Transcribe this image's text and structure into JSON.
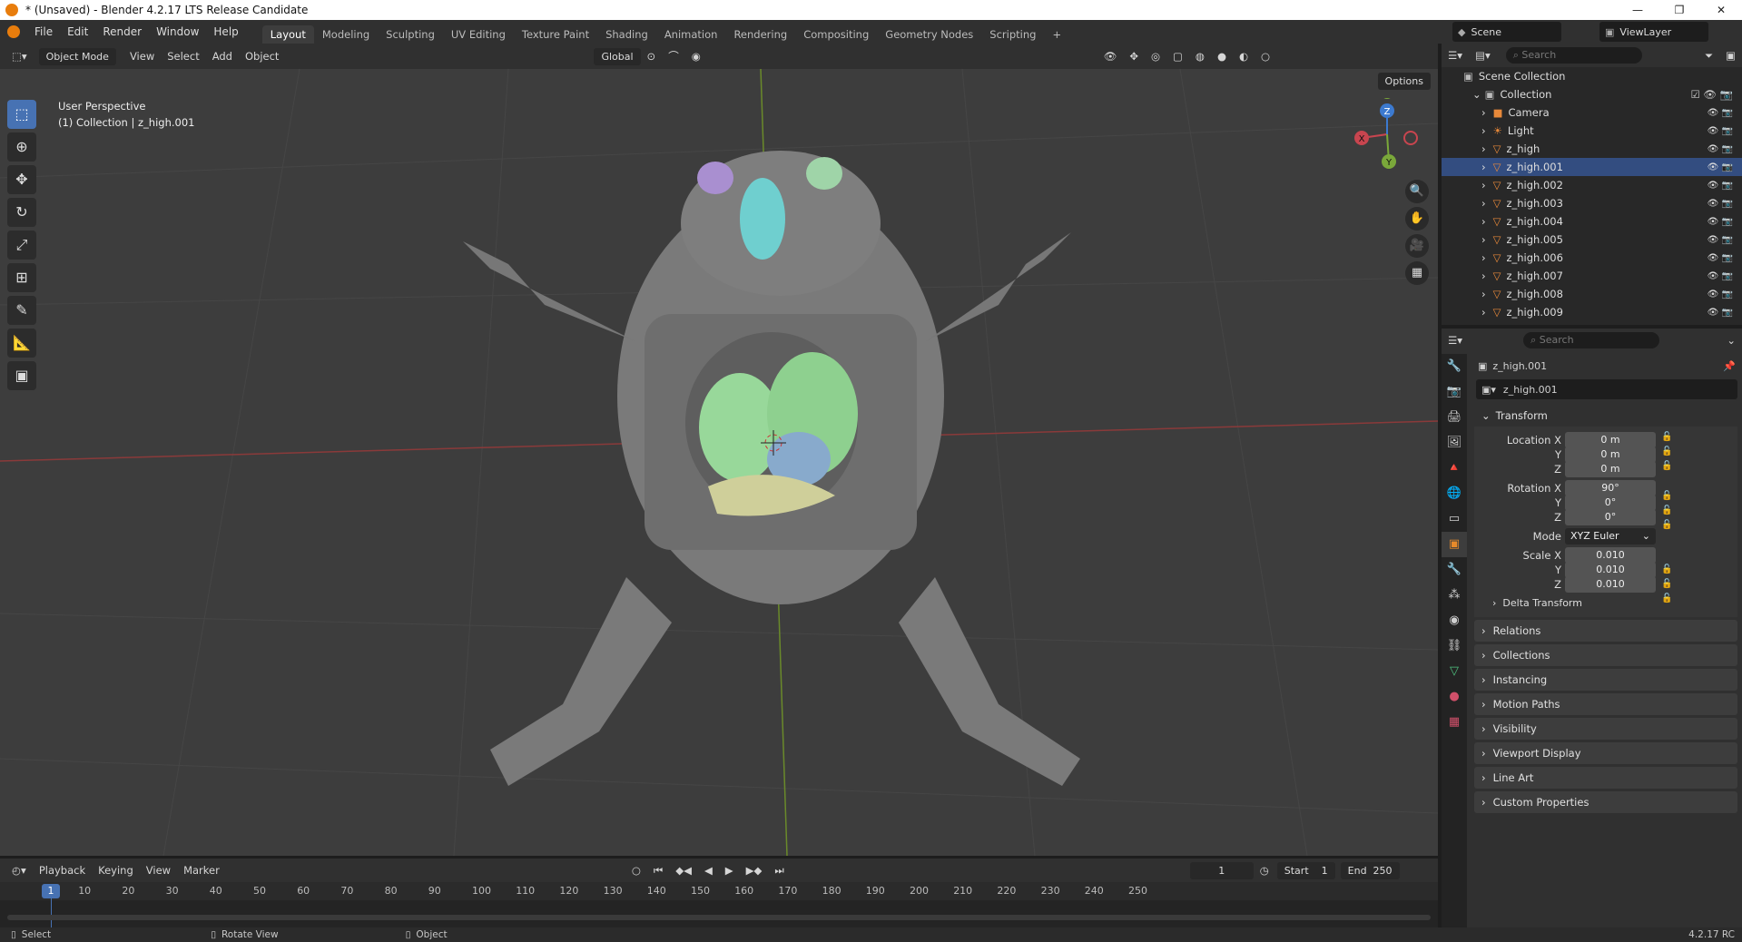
{
  "window": {
    "title": "* (Unsaved) - Blender 4.2.17 LTS Release Candidate",
    "min": "—",
    "max": "❐",
    "close": "✕"
  },
  "menu": {
    "file": "File",
    "edit": "Edit",
    "render": "Render",
    "window": "Window",
    "help": "Help"
  },
  "workspaces": [
    "Layout",
    "Modeling",
    "Sculpting",
    "UV Editing",
    "Texture Paint",
    "Shading",
    "Animation",
    "Rendering",
    "Compositing",
    "Geometry Nodes",
    "Scripting"
  ],
  "add_workspace": "+",
  "scene": {
    "name": "Scene",
    "view_layer": "ViewLayer"
  },
  "viewport_header": {
    "mode": "Object Mode",
    "view": "View",
    "select": "Select",
    "add": "Add",
    "object": "Object",
    "orientation": "Global",
    "options": "Options"
  },
  "viewport": {
    "perspective": "User Perspective",
    "collection_info": "(1) Collection | z_high.001"
  },
  "gizmo": {
    "x": "X",
    "y": "Y",
    "z": "Z"
  },
  "outliner": {
    "search_placeholder": "Search",
    "scene_collection": "Scene Collection",
    "collection": "Collection",
    "items": [
      "Camera",
      "Light",
      "z_high",
      "z_high.001",
      "z_high.002",
      "z_high.003",
      "z_high.004",
      "z_high.005",
      "z_high.006",
      "z_high.007",
      "z_high.008",
      "z_high.009"
    ],
    "selected": "z_high.001"
  },
  "properties": {
    "search_placeholder": "Search",
    "object_name": "z_high.001",
    "data_name": "z_high.001",
    "transform_title": "Transform",
    "location_label": "Location X",
    "location": [
      "0 m",
      "0 m",
      "0 m"
    ],
    "rotation_label": "Rotation X",
    "rotation": [
      "90°",
      "0°",
      "0°"
    ],
    "mode_label": "Mode",
    "mode": "XYZ Euler",
    "scale_label": "Scale X",
    "scale": [
      "0.010",
      "0.010",
      "0.010"
    ],
    "y_label": "Y",
    "z_label": "Z",
    "delta": "Delta Transform",
    "panels": [
      "Relations",
      "Collections",
      "Instancing",
      "Motion Paths",
      "Visibility",
      "Viewport Display",
      "Line Art",
      "Custom Properties"
    ]
  },
  "timeline": {
    "playback": "Playback",
    "keying": "Keying",
    "view": "View",
    "marker": "Marker",
    "current_frame": "1",
    "start_label": "Start",
    "start": "1",
    "end_label": "End",
    "end": "250",
    "ticks": [
      "10",
      "20",
      "30",
      "40",
      "50",
      "60",
      "70",
      "80",
      "90",
      "100",
      "110",
      "120",
      "130",
      "140",
      "150",
      "160",
      "170",
      "180",
      "190",
      "200",
      "210",
      "220",
      "230",
      "240",
      "250"
    ]
  },
  "status": {
    "select": "Select",
    "rotate": "Rotate View",
    "object": "Object",
    "version": "4.2.17 RC"
  }
}
